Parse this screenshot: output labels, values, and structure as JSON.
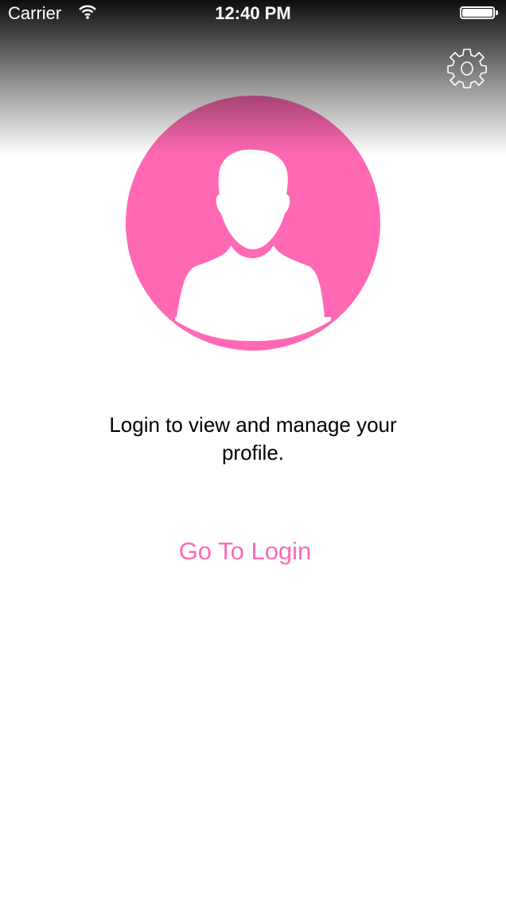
{
  "status_bar": {
    "carrier": "Carrier",
    "time": "12:40 PM",
    "battery_percent": 100
  },
  "header": {
    "settings_icon": "gear-icon"
  },
  "profile": {
    "avatar_icon": "person-silhouette-icon",
    "accent_color": "#FF69B4"
  },
  "message": "Login to view and manage your profile.",
  "login_button": "Go To Login"
}
